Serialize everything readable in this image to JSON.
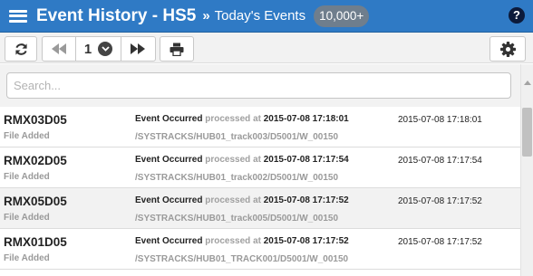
{
  "header": {
    "title": "Event History - HS5",
    "separator": "»",
    "subtitle": "Today's Events",
    "count_badge": "10,000+",
    "help_label": "?"
  },
  "toolbar": {
    "refresh_icon": "refresh-icon",
    "first_icon": "fast-backward-icon",
    "page_number": "1",
    "page_dropdown_icon": "chevron-down-circle-icon",
    "next_icon": "fast-forward-icon",
    "print_icon": "print-icon",
    "settings_icon": "gear-icon"
  },
  "search": {
    "placeholder": "Search..."
  },
  "events": [
    {
      "name": "RMX03D05",
      "type": "File Added",
      "event": "Event Occurred",
      "processed_label": "processed at",
      "processed_time": "2015-07-08 17:18:01",
      "path": "/SYSTRACKS/HUB01_track003/D5001/W_00150",
      "time": "2015-07-08 17:18:01"
    },
    {
      "name": "RMX02D05",
      "type": "File Added",
      "event": "Event Occurred",
      "processed_label": "processed at",
      "processed_time": "2015-07-08 17:17:54",
      "path": "/SYSTRACKS/HUB01_track002/D5001/W_00150",
      "time": "2015-07-08 17:17:54"
    },
    {
      "name": "RMX05D05",
      "type": "File Added",
      "event": "Event Occurred",
      "processed_label": "processed at",
      "processed_time": "2015-07-08 17:17:52",
      "path": "/SYSTRACKS/HUB01_track005/D5001/W_00150",
      "time": "2015-07-08 17:17:52"
    },
    {
      "name": "RMX01D05",
      "type": "File Added",
      "event": "Event Occurred",
      "processed_label": "processed at",
      "processed_time": "2015-07-08 17:17:52",
      "path": "/SYSTRACKS/HUB01_TRACK001/D5001/W_00150",
      "time": "2015-07-08 17:17:52"
    }
  ],
  "colors": {
    "header_bg": "#2f7ac5",
    "badge_bg": "#6f7e8d",
    "selected_row_bg": "#f2f2f2"
  }
}
